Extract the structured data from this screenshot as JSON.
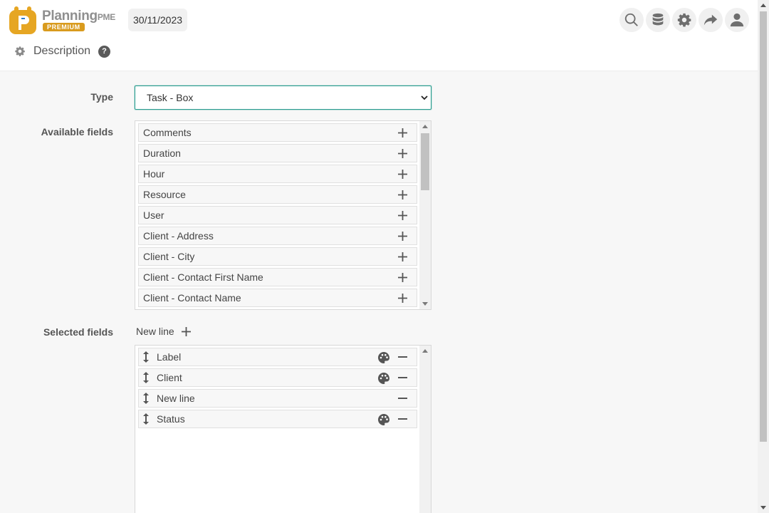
{
  "header": {
    "logo": {
      "brand": "Planning",
      "suffix": "PME",
      "badge": "PREMIUM"
    },
    "date": "30/11/2023",
    "icons": [
      "search-icon",
      "database-icon",
      "gear-icon",
      "share-icon",
      "user-icon"
    ]
  },
  "page": {
    "title": "Description",
    "help": "?"
  },
  "form": {
    "type_label": "Type",
    "type_value": "Task - Box",
    "available_label": "Available fields",
    "available_fields": [
      "Comments",
      "Duration",
      "Hour",
      "Resource",
      "User",
      "Client - Address",
      "Client - City",
      "Client - Contact First Name",
      "Client - Contact Name"
    ],
    "selected_label": "Selected fields",
    "new_line_label": "New line",
    "selected_fields": [
      {
        "label": "Label",
        "palette": true
      },
      {
        "label": "Client",
        "palette": true
      },
      {
        "label": "New line",
        "palette": false
      },
      {
        "label": "Status",
        "palette": true
      }
    ]
  },
  "colors": {
    "accent": "#2a9d8f",
    "brand_gold": "#d99b1e",
    "icon_gray": "#6e6e6e"
  }
}
